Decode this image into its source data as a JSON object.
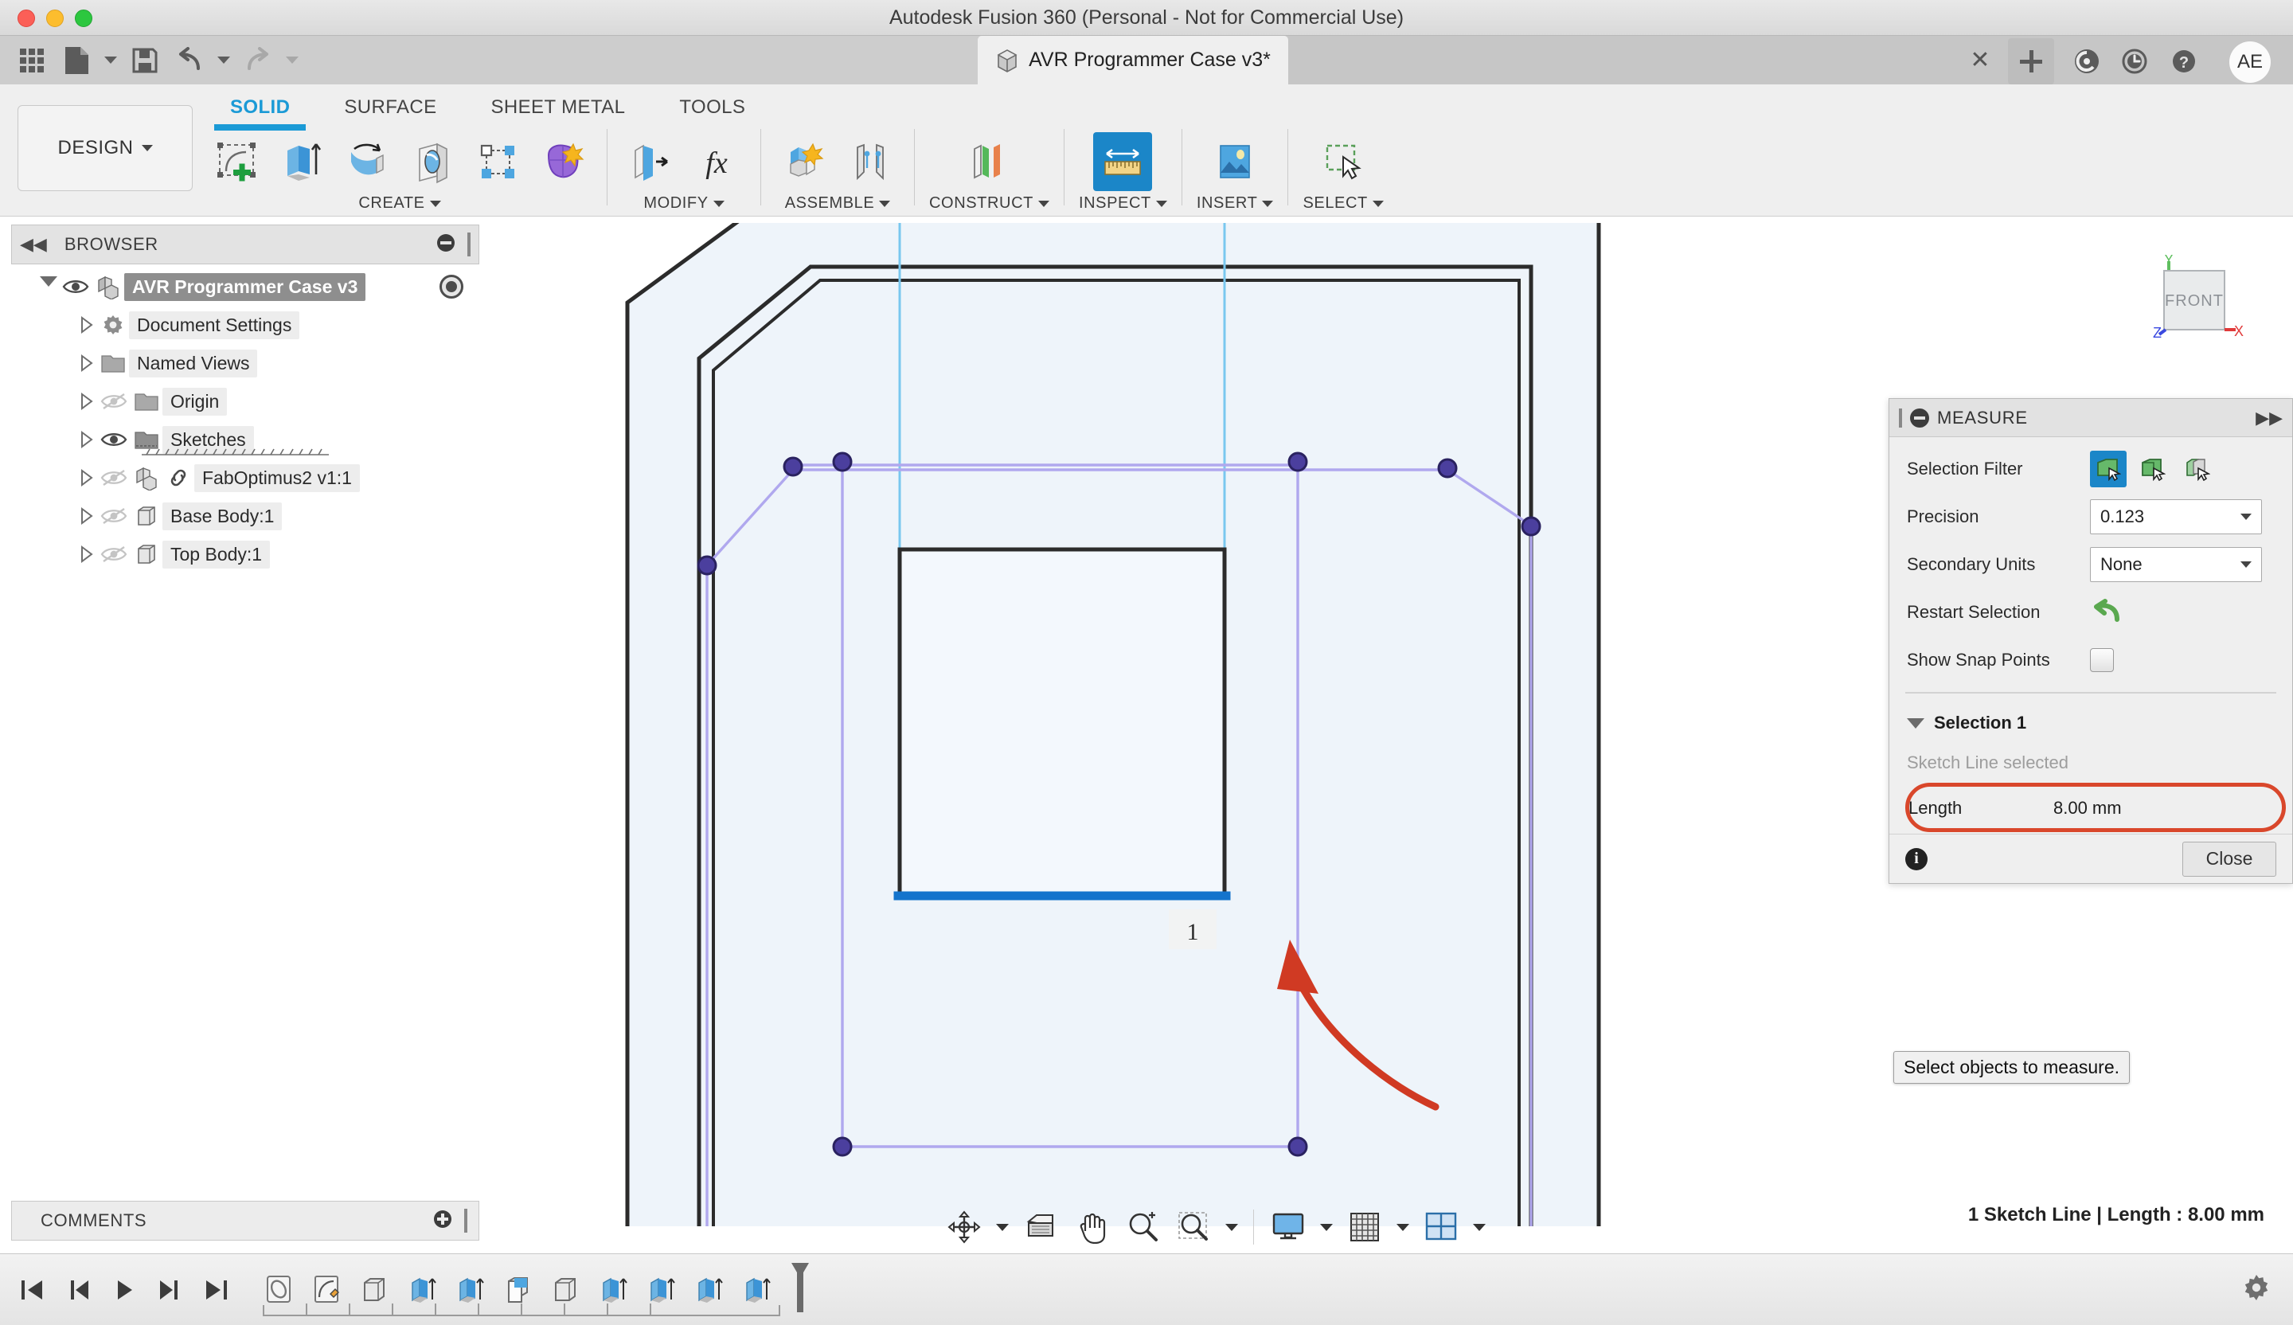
{
  "window": {
    "title": "Autodesk Fusion 360 (Personal - Not for Commercial Use)",
    "traffic_lights": [
      "close",
      "minimize",
      "maximize"
    ]
  },
  "document_tab": {
    "label": "AVR Programmer Case v3*",
    "icon": "body-cube-icon",
    "close_label": "✕",
    "new_tab_label": "+"
  },
  "top_right_icons": [
    {
      "name": "job-status-icon",
      "glyph": ""
    },
    {
      "name": "recent-activity-icon",
      "glyph": ""
    },
    {
      "name": "help-icon",
      "glyph": "?"
    }
  ],
  "account": {
    "initials": "AE"
  },
  "quick_access": [
    {
      "name": "grid-apps-icon",
      "label": "Show Data Panel"
    },
    {
      "name": "file-icon",
      "label": "File"
    },
    {
      "name": "save-icon",
      "label": "Save"
    },
    {
      "name": "undo-icon",
      "label": "Undo"
    },
    {
      "name": "redo-icon",
      "label": "Redo"
    }
  ],
  "ribbon": {
    "workspace_label": "DESIGN",
    "tabs": [
      {
        "label": "SOLID",
        "active": true
      },
      {
        "label": "SURFACE",
        "active": false
      },
      {
        "label": "SHEET METAL",
        "active": false
      },
      {
        "label": "TOOLS",
        "active": false
      }
    ],
    "groups": [
      {
        "name": "CREATE",
        "tools": [
          {
            "name": "create-sketch-icon",
            "label": "Create Sketch"
          },
          {
            "name": "extrude-icon",
            "label": "Extrude"
          },
          {
            "name": "revolve-icon",
            "label": "Revolve"
          },
          {
            "name": "sweep-icon",
            "label": "Sweep"
          },
          {
            "name": "pattern-icon",
            "label": "Pattern"
          },
          {
            "name": "form-icon",
            "label": "Create Form"
          }
        ]
      },
      {
        "name": "MODIFY",
        "tools": [
          {
            "name": "press-pull-icon",
            "label": "Press Pull"
          },
          {
            "name": "change-parameters-icon",
            "label": "Change Parameters"
          }
        ]
      },
      {
        "name": "ASSEMBLE",
        "tools": [
          {
            "name": "new-component-icon",
            "label": "New Component"
          },
          {
            "name": "joint-icon",
            "label": "Joint"
          }
        ]
      },
      {
        "name": "CONSTRUCT",
        "tools": [
          {
            "name": "offset-plane-icon",
            "label": "Offset Plane"
          }
        ]
      },
      {
        "name": "INSPECT",
        "selected": true,
        "tools": [
          {
            "name": "measure-icon",
            "label": "Measure"
          }
        ]
      },
      {
        "name": "INSERT",
        "tools": [
          {
            "name": "insert-image-icon",
            "label": "Decal"
          }
        ]
      },
      {
        "name": "SELECT",
        "tools": [
          {
            "name": "select-window-icon",
            "label": "Select"
          }
        ]
      }
    ]
  },
  "browser": {
    "title": "BROWSER",
    "collapse_icon": "chevrons-left-icon",
    "items": [
      {
        "label": "AVR Programmer Case v3",
        "icon": "component-icon",
        "indent": 0,
        "expanded": true,
        "visible": true,
        "selected": true,
        "has_radio": true
      },
      {
        "label": "Document Settings",
        "icon": "gear-icon",
        "indent": 1,
        "expanded": false,
        "visible": null,
        "selected": false
      },
      {
        "label": "Named Views",
        "icon": "folder-icon",
        "indent": 1,
        "expanded": false,
        "visible": null,
        "selected": false
      },
      {
        "label": "Origin",
        "icon": "folder-icon",
        "indent": 1,
        "expanded": false,
        "visible": false,
        "selected": false
      },
      {
        "label": "Sketches",
        "icon": "sketches-folder-icon",
        "indent": 1,
        "expanded": false,
        "visible": true,
        "selected": false
      },
      {
        "label": "FabOptimus2 v1:1",
        "icon": "linked-component-icon",
        "indent": 1,
        "expanded": false,
        "visible": false,
        "selected": false
      },
      {
        "label": "Base Body:1",
        "icon": "body-icon",
        "indent": 1,
        "expanded": false,
        "visible": false,
        "selected": false
      },
      {
        "label": "Top Body:1",
        "icon": "body-icon",
        "indent": 1,
        "expanded": false,
        "visible": false,
        "selected": false
      }
    ]
  },
  "comments": {
    "title": "COMMENTS",
    "add_icon": "add-comment-icon"
  },
  "viewcube": {
    "face_label": "FRONT",
    "axes": [
      {
        "label": "Y",
        "color": "#5fbf5f"
      },
      {
        "label": "X",
        "color": "#e03a3a"
      },
      {
        "label": "Z",
        "color": "#3a49e0"
      }
    ]
  },
  "viewport": {
    "sketch_label": "1",
    "selected_edge_color": "#1474cc",
    "construction_color": "#b0a8ee",
    "point_color": "#4b3f9e",
    "body_fill": "#eff5fb",
    "annotation_arrow_color": "#d03a23",
    "background": "#ffffff"
  },
  "nav_toolbar": [
    {
      "name": "orbit-icon",
      "label": "Orbit",
      "has_caret": true
    },
    {
      "name": "look-at-icon",
      "label": "Look At",
      "has_caret": false
    },
    {
      "name": "pan-icon",
      "label": "Pan",
      "has_caret": false
    },
    {
      "name": "zoom-icon",
      "label": "Zoom",
      "has_caret": false
    },
    {
      "name": "zoom-window-icon",
      "label": "Fit",
      "has_caret": true
    },
    {
      "name": "display-settings-icon",
      "label": "Display Settings",
      "has_caret": true
    },
    {
      "name": "grid-snaps-icon",
      "label": "Grid and Snaps",
      "has_caret": true
    },
    {
      "name": "viewports-icon",
      "label": "Viewports",
      "has_caret": true
    }
  ],
  "measure_dialog": {
    "title": "MEASURE",
    "expand_icon": "chevrons-right-icon",
    "collapse_icon": "minus-circle-icon",
    "rows": {
      "selection_filter_label": "Selection Filter",
      "selection_filter_options": [
        {
          "name": "filter-face-icon",
          "active": true
        },
        {
          "name": "filter-body-icon",
          "active": false
        },
        {
          "name": "filter-component-icon",
          "active": false
        }
      ],
      "precision_label": "Precision",
      "precision_value": "0.123",
      "secondary_units_label": "Secondary Units",
      "secondary_units_value": "None",
      "restart_selection_label": "Restart Selection",
      "restart_icon": "undo-arrow-icon",
      "show_snap_points_label": "Show Snap Points",
      "show_snap_points_checked": false
    },
    "selection": {
      "header": "Selection 1",
      "note": "Sketch Line selected",
      "result_key": "Length",
      "result_value": "8.00 mm",
      "highlight_color": "#d9472b"
    },
    "footer": {
      "info_icon": "info-icon",
      "close_label": "Close"
    }
  },
  "tooltip": {
    "text": "Select objects to measure."
  },
  "status_bar": {
    "text": "1 Sketch Line | Length : 8.00 mm"
  },
  "timeline": {
    "nav": [
      {
        "name": "go-to-beginning-icon"
      },
      {
        "name": "step-back-icon"
      },
      {
        "name": "play-back-icon"
      },
      {
        "name": "step-forward-icon"
      },
      {
        "name": "go-to-end-icon"
      }
    ],
    "features": [
      {
        "name": "timeline-link-icon"
      },
      {
        "name": "timeline-sketch-icon"
      },
      {
        "name": "timeline-body-icon"
      },
      {
        "name": "timeline-extrude-icon"
      },
      {
        "name": "timeline-extrude-icon"
      },
      {
        "name": "timeline-shell-icon"
      },
      {
        "name": "timeline-body-icon"
      },
      {
        "name": "timeline-extrude-icon"
      },
      {
        "name": "timeline-extrude-icon"
      },
      {
        "name": "timeline-extrude-icon"
      },
      {
        "name": "timeline-extrude-icon"
      }
    ],
    "marker": "timeline-end-marker"
  },
  "settings": {
    "icon": "gear-icon"
  }
}
